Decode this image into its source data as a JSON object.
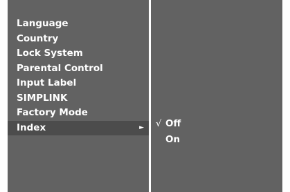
{
  "menu": {
    "items": [
      {
        "label": "Language"
      },
      {
        "label": "Country"
      },
      {
        "label": "Lock System"
      },
      {
        "label": "Parental Control"
      },
      {
        "label": "Input Label"
      },
      {
        "label": "SIMPLINK"
      },
      {
        "label": "Factory Mode"
      },
      {
        "label": "Index",
        "selected": true,
        "arrow": "►"
      }
    ]
  },
  "submenu": {
    "items": [
      {
        "label": "Off",
        "checked": true,
        "check_mark": "√"
      },
      {
        "label": "On",
        "checked": false
      }
    ]
  },
  "colors": {
    "panel": "#626262",
    "highlight": "#4c4c4c",
    "text": "#ffffff",
    "divider": "#ffffff"
  }
}
